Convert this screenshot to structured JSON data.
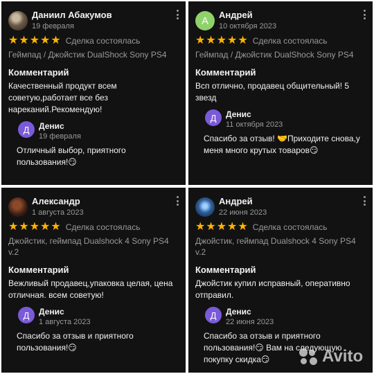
{
  "reviews": [
    {
      "author": "Даниил Абакумов",
      "date": "19 февраля",
      "avatar_letter": "",
      "deal_text": "Сделка состоялась",
      "item": "Геймпад / Джойстик DualShock Sony PS4",
      "comment_label": "Комментарий",
      "comment": "Качественный продукт всем советую,работает все без нареканий.Рекомендую!",
      "reply": {
        "author": "Денис",
        "avatar_letter": "Д",
        "date": "19 февраля",
        "text": "Отличный выбор, приятного пользования!😏"
      }
    },
    {
      "author": "Андрей",
      "date": "10 октября 2023",
      "avatar_letter": "А",
      "deal_text": "Сделка состоялась",
      "item": "Геймпад / Джойстик DualShock Sony PS4",
      "comment_label": "Комментарий",
      "comment": "Всп отлично, продавец общительный! 5 звезд",
      "reply": {
        "author": "Денис",
        "avatar_letter": "Д",
        "date": "11 октября 2023",
        "text": "Спасибо за отзыв! 🤝Приходите снова,у меня много крутых товаров😏"
      }
    },
    {
      "author": "Александр",
      "date": "1 августа 2023",
      "avatar_letter": "",
      "deal_text": "Сделка состоялась",
      "item": "Джойстик, геймпад Dualshock 4 Sony PS4 v.2",
      "comment_label": "Комментарий",
      "comment": "Вежливый продавец,упаковка целая, цена отличная. всем советую!",
      "reply": {
        "author": "Денис",
        "avatar_letter": "Д",
        "date": "1 августа 2023",
        "text": "Спасибо за отзыв и приятного пользования!😏"
      }
    },
    {
      "author": "Андрей",
      "date": "22 июня 2023",
      "avatar_letter": "",
      "deal_text": "Сделка состоялась",
      "item": "Джойстик, геймпад Dualshock 4 Sony PS4 v.2",
      "comment_label": "Комментарий",
      "comment": "Джойстик купил исправный, оперативно отправил.",
      "reply": {
        "author": "Денис",
        "avatar_letter": "Д",
        "date": "22 июня 2023",
        "text": "Спасибо за отзыв и приятного пользования!😏 Вам на следующую покупку скидка😏"
      }
    }
  ],
  "stars": "★★★★★",
  "watermark": "Avito",
  "colors": {
    "card_bg": "#121212",
    "star": "#ffb400",
    "muted": "#9a9a9a",
    "reply_avatar": "#7a5ad9",
    "green_avatar": "#8fd16a"
  }
}
